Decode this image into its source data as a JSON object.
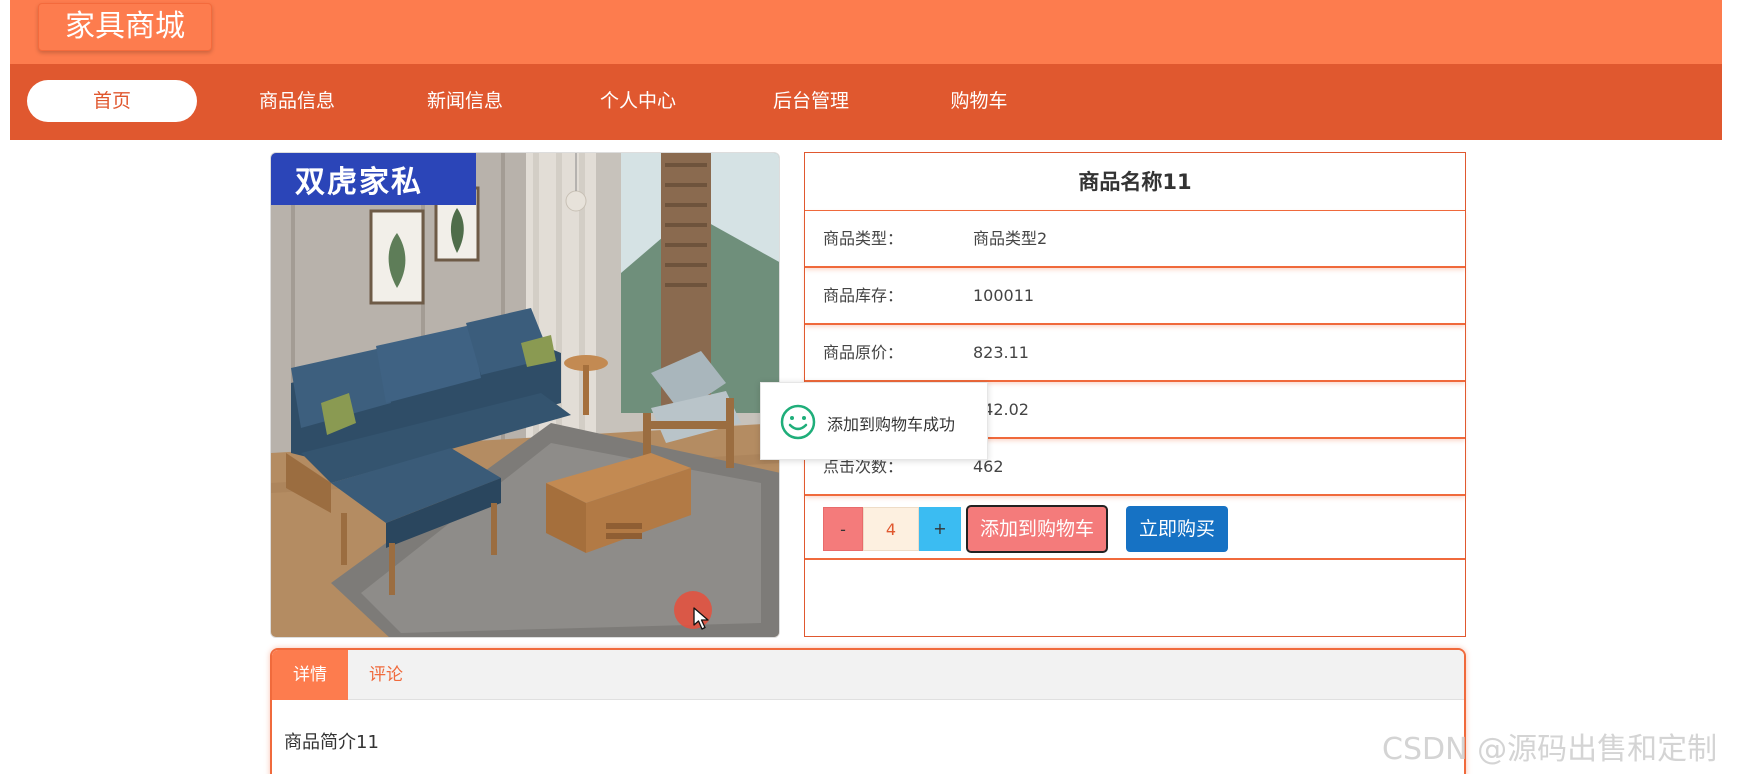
{
  "header": {
    "logo_text": "家具商城"
  },
  "nav": {
    "items": [
      {
        "label": "首页",
        "active": true
      },
      {
        "label": "商品信息",
        "active": false
      },
      {
        "label": "新闻信息",
        "active": false
      },
      {
        "label": "个人中心",
        "active": false
      },
      {
        "label": "后台管理",
        "active": false
      },
      {
        "label": "购物车",
        "active": false
      }
    ]
  },
  "product": {
    "image_brand_text": "双虎家私",
    "name": "商品名称11",
    "fields": [
      {
        "label": "商品类型：",
        "value": "商品类型2"
      },
      {
        "label": "商品库存：",
        "value": "100011"
      },
      {
        "label": "商品原价：",
        "value": "823.11"
      },
      {
        "label": "",
        "value": "342.02"
      },
      {
        "label": "点击次数：",
        "value": "462"
      }
    ],
    "quantity": "4",
    "minus_label": "-",
    "plus_label": "+",
    "add_to_cart_label": "添加到购物车",
    "buy_now_label": "立即购买"
  },
  "toast": {
    "message": "添加到购物车成功",
    "icon": "smile-icon"
  },
  "tabs": {
    "items": [
      {
        "label": "详情",
        "active": true
      },
      {
        "label": "评论",
        "active": false
      }
    ],
    "content": "商品简介11"
  },
  "watermark": "CSDN @源码出售和定制",
  "colors": {
    "brand_orange": "#fd7c4e",
    "nav_orange": "#e0582f",
    "add_cart_pink": "#f47b7b",
    "buy_blue": "#1672c4",
    "plus_blue": "#3bbcf2",
    "toast_green": "#1fae7a"
  }
}
